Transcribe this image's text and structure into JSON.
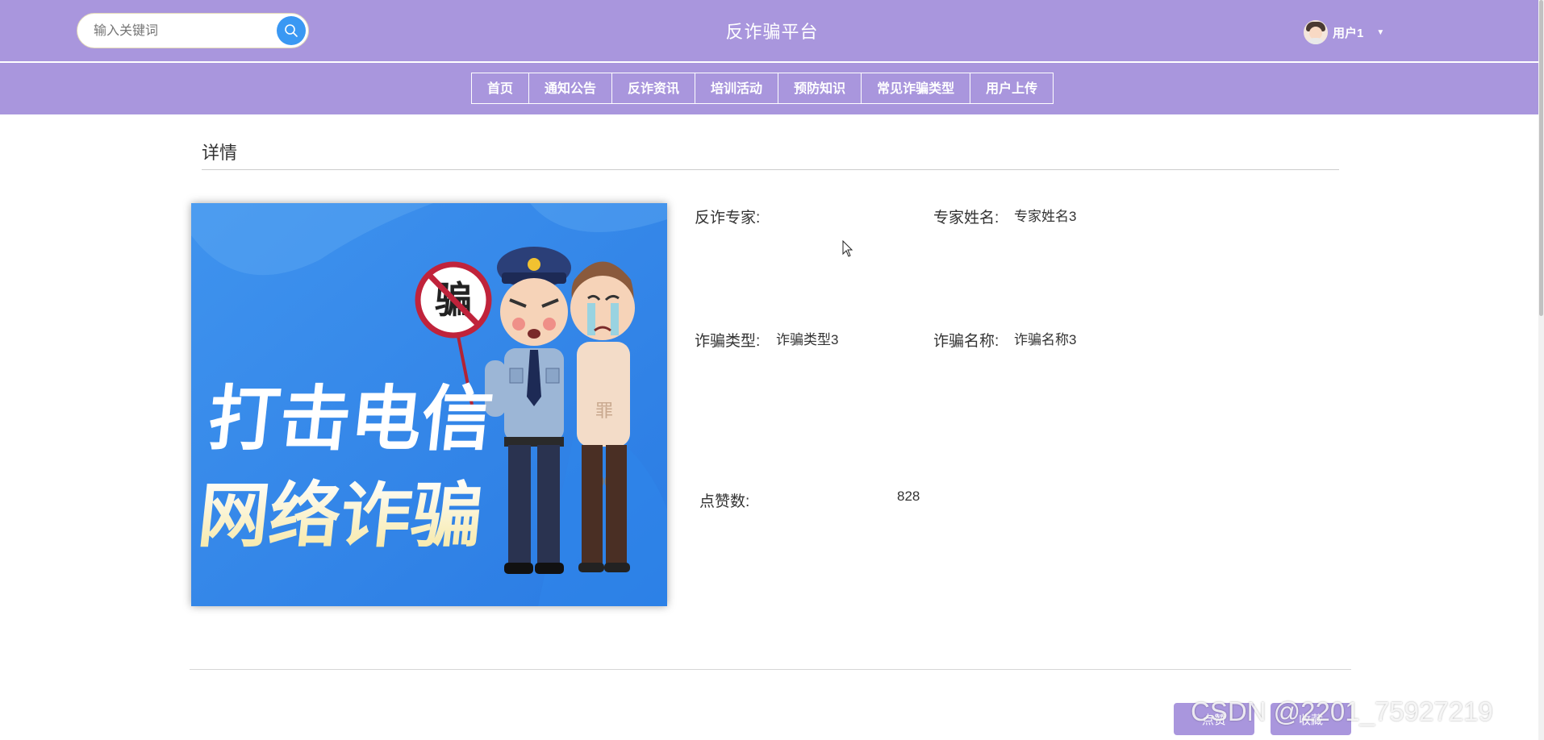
{
  "header": {
    "search_placeholder": "输入关键词",
    "site_title": "反诈骗平台",
    "user_name": "用户1"
  },
  "nav": [
    "首页",
    "通知公告",
    "反诈资讯",
    "培训活动",
    "预防知识",
    "常见诈骗类型",
    "用户上传"
  ],
  "detail": {
    "section_title": "详情",
    "poster": {
      "line1": "打击电信",
      "line2": "网络诈骗",
      "sign": "骗"
    },
    "fields": {
      "expert_label": "反诈专家:",
      "expert_value": "",
      "expert_name_label": "专家姓名:",
      "expert_name_value": "专家姓名3",
      "fraud_type_label": "诈骗类型:",
      "fraud_type_value": "诈骗类型3",
      "fraud_name_label": "诈骗名称:",
      "fraud_name_value": "诈骗名称3",
      "likes_label": "点赞数:",
      "likes_value": "828"
    },
    "buttons": {
      "like": "点赞",
      "favorite": "收藏"
    }
  },
  "watermark": "CSDN @2201_75927219",
  "colors": {
    "theme": "#a996dd",
    "search_button": "#3a98f3",
    "poster_bg": "#2d83e6"
  }
}
